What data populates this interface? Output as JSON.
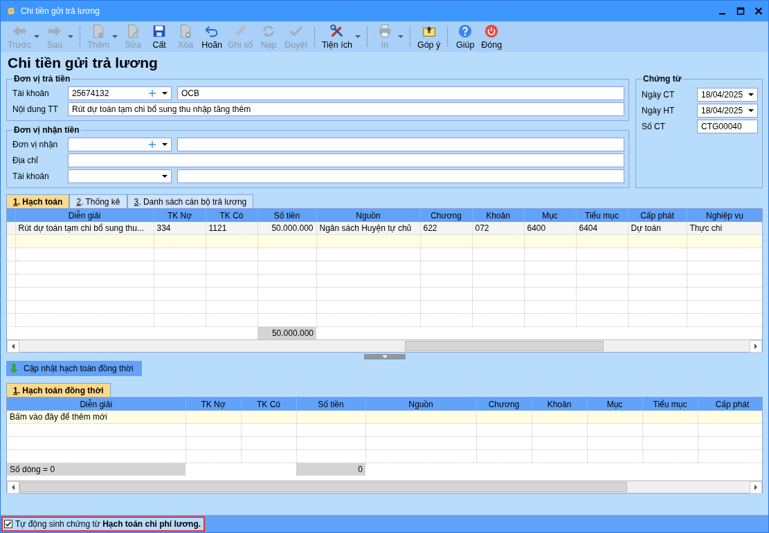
{
  "window": {
    "title": "Chi tiền gửi trả lương"
  },
  "toolbar": [
    {
      "items": [
        {
          "kind": "back",
          "label": "Trước",
          "disabled": true,
          "dropdown": true
        },
        {
          "kind": "forward",
          "label": "Sau",
          "disabled": true,
          "dropdown": true
        }
      ]
    },
    {
      "items": [
        {
          "kind": "new",
          "label": "Thêm",
          "disabled": true,
          "dropdown": true
        },
        {
          "kind": "edit",
          "label": "Sửa",
          "disabled": true,
          "dropdown": false
        },
        {
          "kind": "save",
          "label": "Cất",
          "disabled": false,
          "dropdown": false
        },
        {
          "kind": "delete",
          "label": "Xóa",
          "disabled": true,
          "dropdown": false
        },
        {
          "kind": "undo",
          "label": "Hoãn",
          "disabled": false,
          "dropdown": false
        },
        {
          "kind": "post",
          "label": "Ghi sổ",
          "disabled": true,
          "dropdown": false
        },
        {
          "kind": "reload",
          "label": "Nạp",
          "disabled": true,
          "dropdown": false
        },
        {
          "kind": "approve",
          "label": "Duyệt",
          "disabled": true,
          "dropdown": false
        }
      ]
    },
    {
      "items": [
        {
          "kind": "tools",
          "label": "Tiện ích",
          "disabled": false,
          "dropdown": true
        }
      ]
    },
    {
      "items": [
        {
          "kind": "print",
          "label": "In",
          "disabled": true,
          "dropdown": true
        }
      ]
    },
    {
      "items": [
        {
          "kind": "feedback",
          "label": "Góp ý",
          "disabled": false,
          "dropdown": false
        }
      ]
    },
    {
      "items": [
        {
          "kind": "help",
          "label": "Giúp",
          "disabled": false,
          "dropdown": false
        },
        {
          "kind": "close",
          "label": "Đóng",
          "disabled": false,
          "dropdown": false
        }
      ]
    }
  ],
  "heading": "Chi tiền gửi trả lương",
  "payer": {
    "legend": "Đơn vị trả tiền",
    "fields": [
      {
        "kind": "account",
        "label": "Tài khoản",
        "value": "25674132",
        "add": true,
        "name_value": "OCB"
      },
      {
        "kind": "text",
        "label": "Nội dung TT",
        "value": "Rút dự toán tạm chi bổ sung thu nhập tăng thêm"
      }
    ]
  },
  "payee": {
    "legend": "Đơn vị nhận tiền",
    "fields": [
      {
        "kind": "account",
        "label": "Đơn vị nhận",
        "add": true
      },
      {
        "kind": "text",
        "label": "Địa chỉ"
      },
      {
        "kind": "account",
        "label": "Tài khoản",
        "add": false
      }
    ]
  },
  "voucher": {
    "legend": "Chứng từ",
    "fields": [
      {
        "kind": "date",
        "label": "Ngày CT",
        "value": "18/04/2025"
      },
      {
        "kind": "date",
        "label": "Ngày HT",
        "value": "18/04/2025"
      },
      {
        "kind": "text",
        "label": "Số CT",
        "value": "CTG00040"
      }
    ]
  },
  "tabs": [
    {
      "key": "1",
      "label": ". Hạch toán",
      "selected": true
    },
    {
      "key": "2",
      "label": ". Thống kê",
      "selected": false
    },
    {
      "key": "3",
      "label": ". Danh sách cán bộ trả lương",
      "selected": false
    }
  ],
  "grid": {
    "columns": [
      {
        "label": "Diễn giải",
        "kind": "text"
      },
      {
        "label": "TK Nợ",
        "kind": "text"
      },
      {
        "label": "TK Có",
        "kind": "text"
      },
      {
        "label": "Số tiền",
        "kind": "amount",
        "total": "50.000.000"
      },
      {
        "label": "Nguồn",
        "kind": "text"
      },
      {
        "label": "Chương",
        "kind": "text"
      },
      {
        "label": "Khoản",
        "kind": "text"
      },
      {
        "label": "Mục",
        "kind": "text"
      },
      {
        "label": "Tiểu mục",
        "kind": "text"
      },
      {
        "label": "Cấp phát",
        "kind": "text"
      },
      {
        "label": "Nghiệp vụ",
        "kind": "text"
      }
    ],
    "rows": [
      {
        "cells": [
          "Rút dự toán tạm chi bổ sung thu...",
          "334",
          "1121",
          "50.000.000",
          "Ngân sách Huyện tự chủ",
          "622",
          "072",
          "6400",
          "6404",
          "Dự toán",
          "Thực chi"
        ]
      }
    ]
  },
  "update_button": "Cập nhật hạch toán đồng thời",
  "tabs2": [
    {
      "key": "1",
      "label": ". Hạch toán đồng thời",
      "selected": true
    }
  ],
  "grid2": {
    "columns": [
      {
        "label": "Diễn giải",
        "kind": "text",
        "total": "Số dòng = 0"
      },
      {
        "label": "TK Nợ",
        "kind": "text"
      },
      {
        "label": "TK Có",
        "kind": "text"
      },
      {
        "label": "Số tiền",
        "kind": "amount",
        "total": "0"
      },
      {
        "label": "Nguồn",
        "kind": "text"
      },
      {
        "label": "Chương",
        "kind": "text"
      },
      {
        "label": "Khoản",
        "kind": "text"
      },
      {
        "label": "Mục",
        "kind": "text"
      },
      {
        "label": "Tiểu mục",
        "kind": "text"
      },
      {
        "label": "Cấp phát",
        "kind": "text"
      }
    ],
    "new_row_hint": "Bấm vào đây để thêm mới"
  },
  "status": {
    "checked": true,
    "text": "Tự động sinh chứng từ **Hạch toán chi phí lương.**"
  }
}
